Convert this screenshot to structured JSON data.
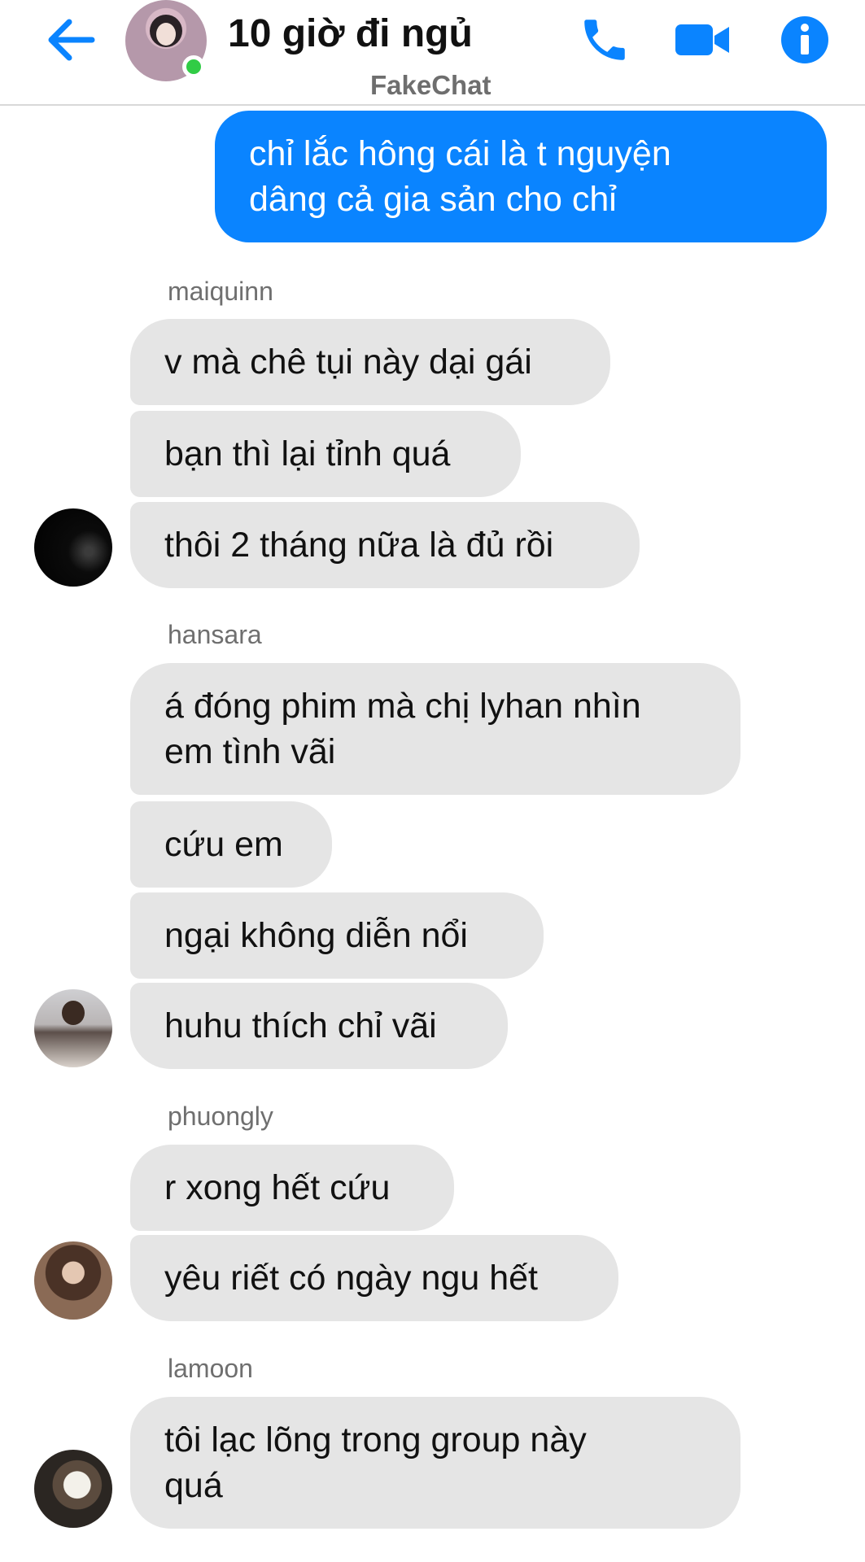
{
  "header": {
    "title": "10 giờ đi ngủ",
    "subtitle": "FakeChat"
  },
  "colors": {
    "accent": "#0a84ff",
    "incoming_bubble": "#e5e5e5",
    "online": "#31cc46"
  },
  "messages": {
    "outgoing": {
      "line1": "chỉ lắc hông cái là t nguyện",
      "line2": "dâng cả gia sản cho chỉ"
    },
    "groups": [
      {
        "sender": "maiquinn",
        "avatar": "avatar-dark",
        "bubbles": [
          "v mà chê tụi này dại gái",
          "bạn thì lại tỉnh quá",
          "thôi 2 tháng nữa là đủ rồi"
        ]
      },
      {
        "sender": "hansara",
        "avatar": "avatar-selfie",
        "bubbles": [
          [
            "á đóng phim mà chị lyhan nhìn",
            "em tình vãi"
          ],
          "cứu em",
          "ngại không diễn nổi",
          "huhu thích chỉ vãi"
        ]
      },
      {
        "sender": "phuongly",
        "avatar": "avatar-portrait",
        "bubbles": [
          "r xong hết cứu",
          "yêu riết có ngày ngu hết"
        ]
      },
      {
        "sender": "lamoon",
        "avatar": "avatar-cat",
        "bubbles": [
          [
            "tôi lạc lõng trong group này",
            "quá"
          ]
        ]
      }
    ]
  },
  "icons": {
    "back": "arrow-left-icon",
    "call": "phone-icon",
    "video": "video-camera-icon",
    "info": "info-icon"
  }
}
